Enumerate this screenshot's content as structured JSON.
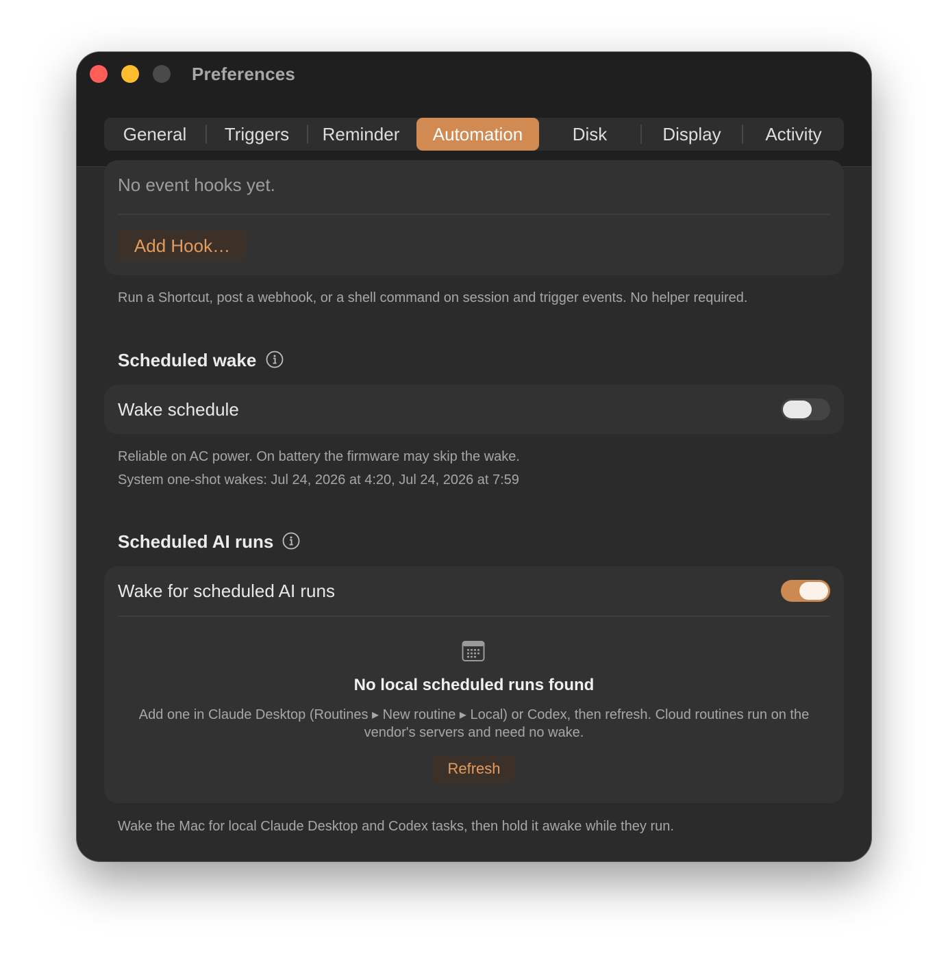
{
  "window": {
    "title": "Preferences"
  },
  "tabs": [
    {
      "label": "General"
    },
    {
      "label": "Triggers"
    },
    {
      "label": "Reminder"
    },
    {
      "label": "Automation",
      "active": true
    },
    {
      "label": "Disk"
    },
    {
      "label": "Display"
    },
    {
      "label": "Activity"
    }
  ],
  "hooks": {
    "empty_text": "No event hooks yet.",
    "add_button": "Add Hook…",
    "caption": "Run a Shortcut, post a webhook, or a shell command on session and trigger events. No helper required."
  },
  "scheduled_wake": {
    "heading": "Scheduled wake",
    "toggle_label": "Wake schedule",
    "toggle_on": false,
    "caption_line1": "Reliable on AC power. On battery the firmware may skip the wake.",
    "caption_line2": "System one-shot wakes: Jul 24, 2026 at 4:20, Jul 24, 2026 at 7:59"
  },
  "scheduled_ai": {
    "heading": "Scheduled AI runs",
    "toggle_label": "Wake for scheduled AI runs",
    "toggle_on": true,
    "empty_title": "No local scheduled runs found",
    "empty_desc": "Add one in Claude Desktop (Routines ▸ New routine ▸ Local) or Codex, then refresh. Cloud routines run on the vendor's servers and need no wake.",
    "refresh_button": "Refresh",
    "caption": "Wake the Mac for local Claude Desktop and Codex tasks, then hold it awake while they run."
  },
  "icons": {
    "info": "info-circle-icon",
    "calendar": "calendar-icon"
  },
  "colors": {
    "accent": "#d08a52",
    "window_bg": "#2b2b2b",
    "card_bg": "#323232"
  }
}
